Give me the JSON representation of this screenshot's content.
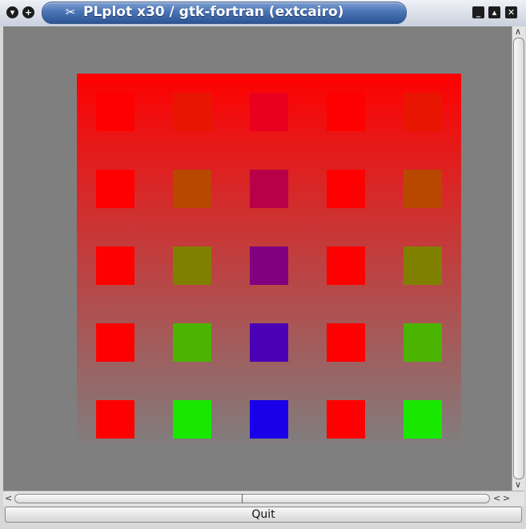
{
  "window": {
    "title": "PLplot x30 / gtk-fortran (extcairo)",
    "menu_glyph": "▾",
    "pin_glyph": "+",
    "minimize_glyph": "_",
    "maximize_glyph": "▴",
    "close_glyph": "✕",
    "app_icon_glyph": "✂"
  },
  "plot": {
    "background_color": "#7f7f7f",
    "gradient_top": "#ff0000",
    "gradient_bottom": "#7f7f7f",
    "rows": [
      [
        "#ff0000",
        "#e81600",
        "#e8001e",
        "#ff0000",
        "#e81600"
      ],
      [
        "#ff0000",
        "#b84800",
        "#b80048",
        "#ff0000",
        "#b84800"
      ],
      [
        "#ff0000",
        "#808000",
        "#800080",
        "#ff0000",
        "#808000"
      ],
      [
        "#ff0000",
        "#4ab400",
        "#4a00b4",
        "#ff0000",
        "#4ab400"
      ],
      [
        "#ff0000",
        "#18e800",
        "#1800e8",
        "#ff0000",
        "#18e800"
      ]
    ]
  },
  "scrollbars": {
    "up_arrow": "∧",
    "down_arrow": "∨",
    "left_arrow": "<",
    "right_arrow": ">"
  },
  "quit_button": {
    "label": "Quit"
  }
}
